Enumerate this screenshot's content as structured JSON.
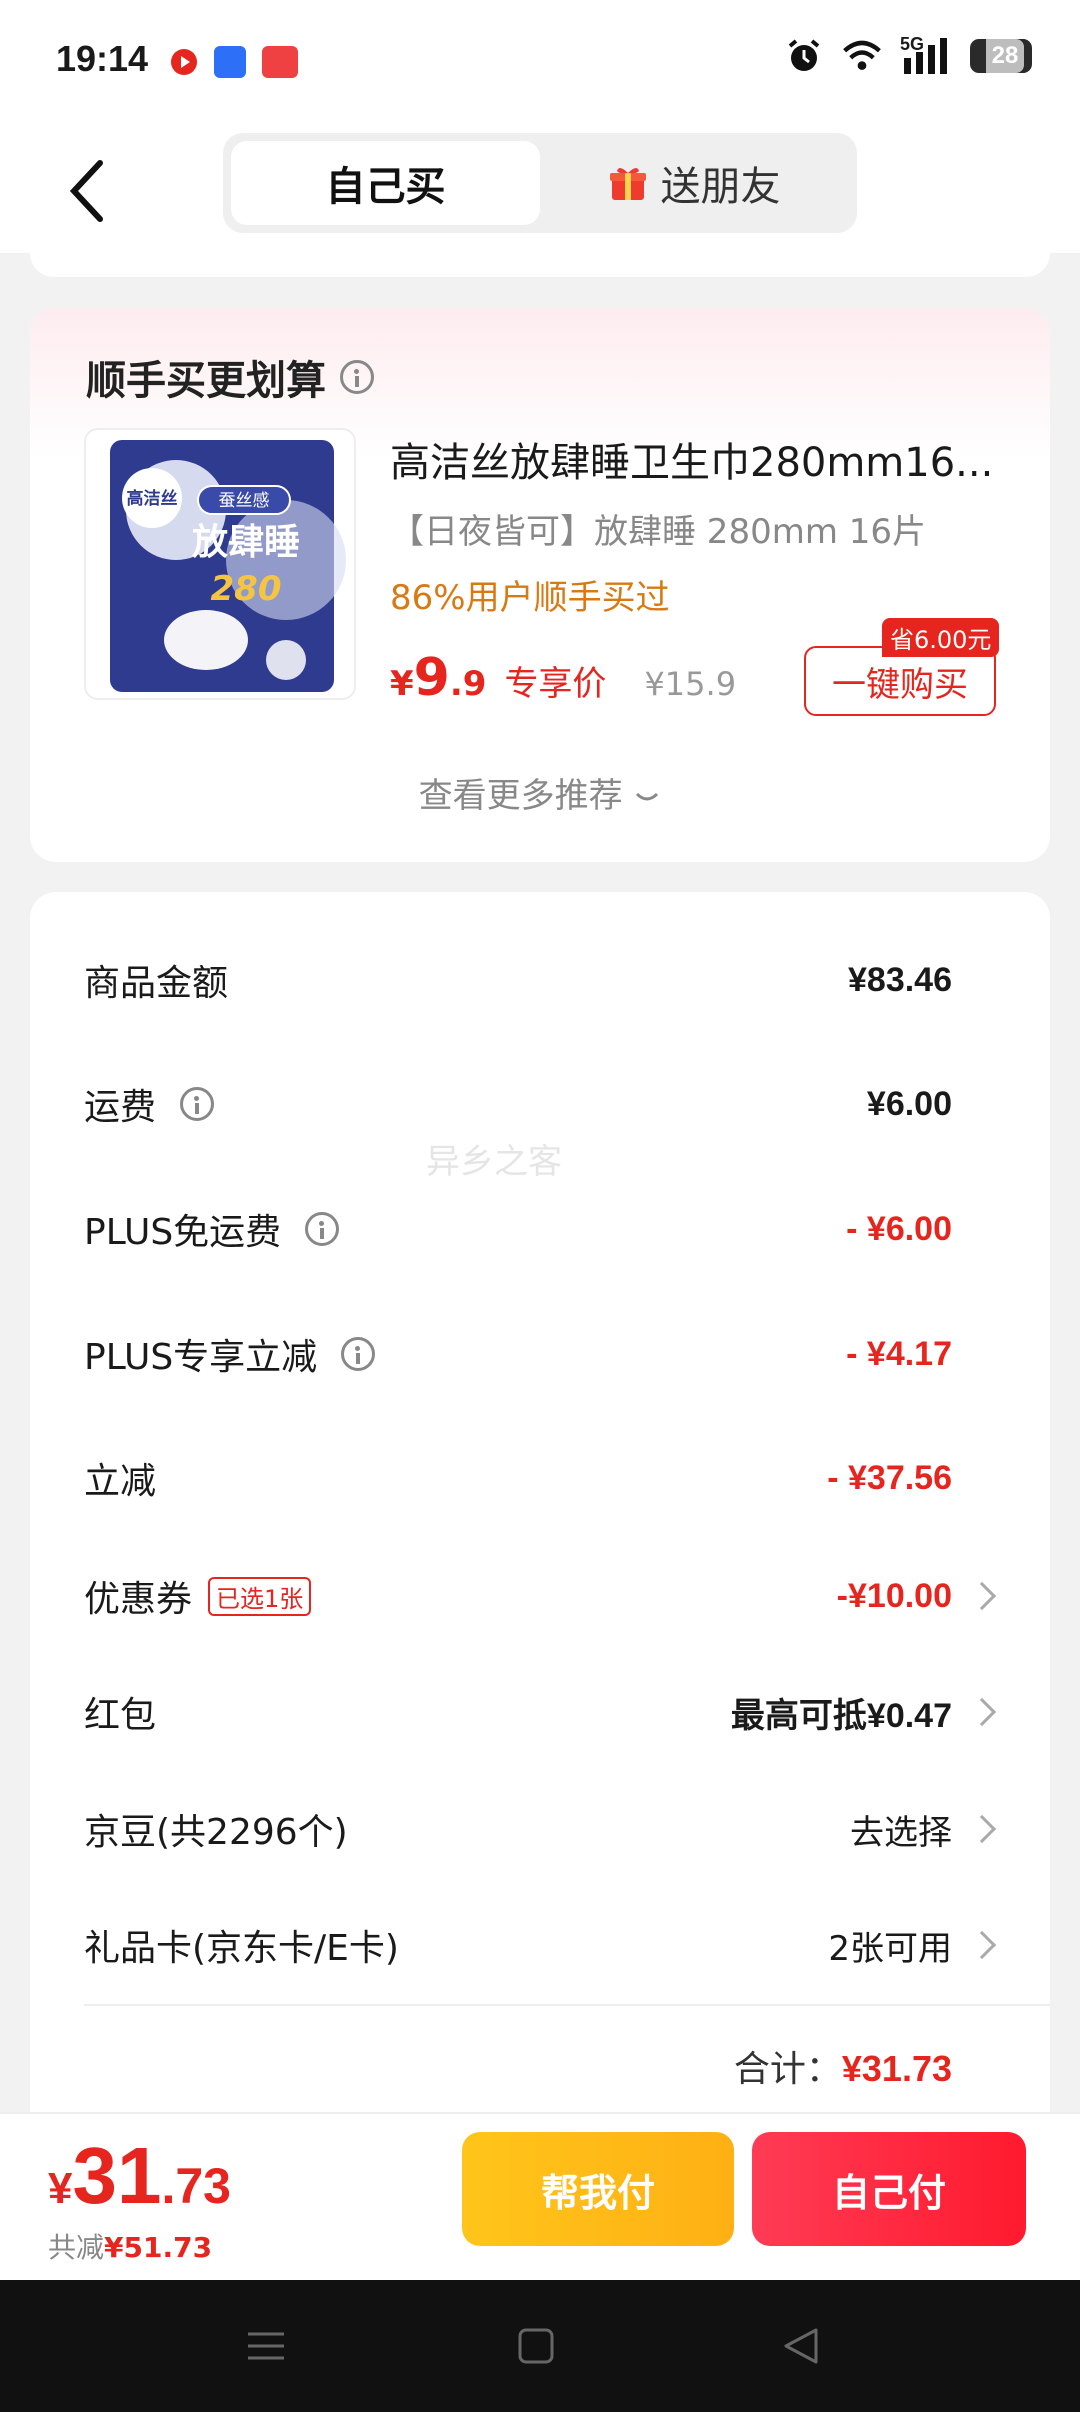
{
  "status_bar": {
    "time": "19:14",
    "network": "5G",
    "battery": "28",
    "icons": [
      "alarm-icon",
      "wifi-icon",
      "signal-icon",
      "battery-icon"
    ]
  },
  "header": {
    "tabs": [
      {
        "label": "自己买",
        "active": true
      },
      {
        "label": "送朋友",
        "active": false
      }
    ]
  },
  "recommend": {
    "title": "顺手买更划算",
    "product": {
      "name": "高洁丝放肆睡卫生巾280mm16...",
      "spec": "【日夜皆可】放肆睡 280mm 16片",
      "hint": "86%用户顺手买过",
      "price_symbol": "¥",
      "price_int": "9",
      "price_dec": ".9",
      "price_tag": "专享价",
      "old_price": "¥15.9",
      "save_badge": "省6.00元",
      "buy_label": "一键购买",
      "package_text": {
        "brand": "高洁丝",
        "line": "蚕丝感",
        "name": "放肆睡",
        "size": "280"
      }
    },
    "more_label": "查看更多推荐"
  },
  "summary": {
    "watermark": "异乡之客",
    "rows": [
      {
        "label": "商品金额",
        "value": "¥83.46"
      },
      {
        "label": "运费",
        "value": "¥6.00"
      },
      {
        "label": "PLUS免运费",
        "value": "- ¥6.00"
      },
      {
        "label": "PLUS专享立减",
        "value": "- ¥4.17"
      },
      {
        "label": "立减",
        "value": "- ¥37.56"
      },
      {
        "label": "优惠券",
        "tag": "已选1张",
        "value": "-¥10.00"
      },
      {
        "label": "红包",
        "value": "最高可抵¥0.47"
      },
      {
        "label": "京豆(共2296个)",
        "value": "去选择"
      },
      {
        "label": "礼品卡(京东卡/E卡)",
        "value": "2张可用"
      }
    ],
    "total_label": "合计：",
    "total_value": "¥31.73"
  },
  "bottom_bar": {
    "price_symbol": "¥",
    "price_int": "31",
    "price_dec": ".73",
    "saved_label": "共减",
    "saved_value": "¥51.73",
    "help_pay_label": "帮我付",
    "self_pay_label": "自己付"
  },
  "colors": {
    "accent_red": "#e5251e",
    "hint_orange": "#d87a14",
    "help_btn": "#ffbb17",
    "self_btn": "#ff2a40"
  }
}
